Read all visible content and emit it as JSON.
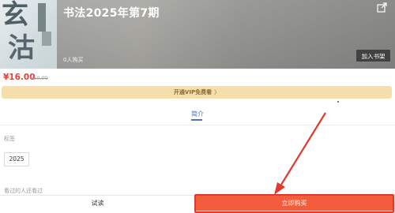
{
  "header": {
    "title": "书法2025年第7期",
    "buyers": "0人购买",
    "add_to_shelf": "加入书架",
    "cover_chars": [
      "玄",
      "沽"
    ],
    "external_icon": "share-external-icon"
  },
  "pricing": {
    "price": "¥16.00",
    "original_price": "¥50.00"
  },
  "vip": {
    "label": "开通VIP免费看",
    "chevron": "〉"
  },
  "tabs": {
    "intro": "简介"
  },
  "sections": {
    "tags_label": "标签",
    "tag_chip": "2025",
    "also_viewed_label": "看过的人还看过"
  },
  "footer": {
    "trial": "试读",
    "buy_now": "立即购买"
  },
  "colors": {
    "price": "#e4433a",
    "buy_button": "#f35c3c",
    "tab_accent": "#4a74c4",
    "vip_bg": "#f5deaa",
    "annotation_red": "#e03a2f"
  }
}
